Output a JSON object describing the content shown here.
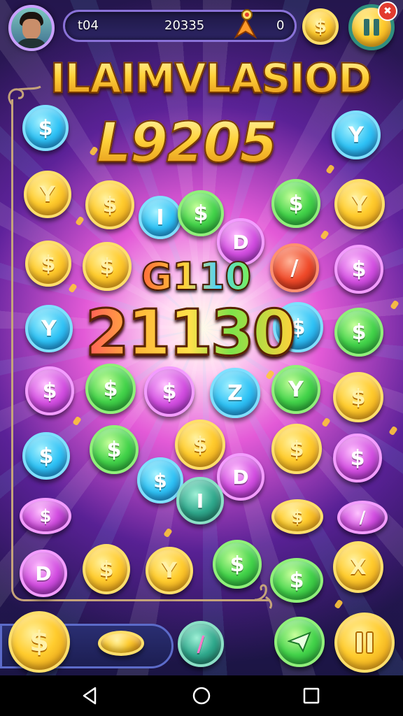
{
  "top_bar": {
    "avatar": "player-avatar",
    "stat_left": "t04",
    "stat_mid": "20335",
    "stat_right": "0",
    "rocket_icon": "rocket-icon",
    "coin_button_icon": "dollar-coin-icon",
    "pause_button_icon": "pause-icon",
    "close_badge": "✖"
  },
  "title": "ILAIMVLASIOD",
  "score": "L9205",
  "combo_text": "G110",
  "points_text": "21130",
  "coins": [
    {
      "color": "cyan",
      "symbol": "$"
    },
    {
      "color": "cyan",
      "symbol": "Y"
    },
    {
      "color": "gold",
      "symbol": "Y"
    },
    {
      "color": "gold",
      "symbol": "$"
    },
    {
      "color": "cyan",
      "symbol": "I"
    },
    {
      "color": "green",
      "symbol": "$"
    },
    {
      "color": "green",
      "symbol": "$"
    },
    {
      "color": "gold",
      "symbol": "Y"
    },
    {
      "color": "magenta",
      "symbol": "D"
    },
    {
      "color": "gold",
      "symbol": "$"
    },
    {
      "color": "gold",
      "symbol": "$"
    },
    {
      "color": "red",
      "symbol": "/"
    },
    {
      "color": "magenta",
      "symbol": "$"
    },
    {
      "color": "cyan",
      "symbol": "Y"
    },
    {
      "color": "cyan",
      "symbol": "$"
    },
    {
      "color": "green",
      "symbol": "$"
    },
    {
      "color": "magenta",
      "symbol": "$"
    },
    {
      "color": "green",
      "symbol": "$"
    },
    {
      "color": "magenta",
      "symbol": "$"
    },
    {
      "color": "cyan",
      "symbol": "Z"
    },
    {
      "color": "green",
      "symbol": "Y"
    },
    {
      "color": "gold",
      "symbol": "$"
    },
    {
      "color": "cyan",
      "symbol": "$"
    },
    {
      "color": "green",
      "symbol": "$"
    },
    {
      "color": "gold",
      "symbol": "$"
    },
    {
      "color": "gold",
      "symbol": "$"
    },
    {
      "color": "magenta",
      "symbol": "$"
    },
    {
      "color": "cyan",
      "symbol": "$"
    },
    {
      "color": "magenta",
      "symbol": "D"
    },
    {
      "color": "teal",
      "symbol": "I"
    },
    {
      "color": "magenta",
      "symbol": "$"
    },
    {
      "color": "gold",
      "symbol": "$"
    },
    {
      "color": "green",
      "symbol": "$"
    },
    {
      "color": "magenta",
      "symbol": "/"
    },
    {
      "color": "magenta",
      "symbol": "D"
    },
    {
      "color": "gold",
      "symbol": "$"
    },
    {
      "color": "gold",
      "symbol": "Y"
    },
    {
      "color": "green",
      "symbol": "$"
    },
    {
      "color": "gold",
      "symbol": "X"
    },
    {
      "color": "gold",
      "symbol": "$"
    }
  ],
  "bottom_bar": {
    "coin_button_symbol": "$",
    "pencil_button_symbol": "/",
    "play_button_icon": "paper-plane-icon",
    "pause_button_icon": "pause-icon"
  },
  "navbar": {
    "back_icon": "back-triangle-icon",
    "home_icon": "home-circle-icon",
    "recents_icon": "recents-square-icon"
  },
  "colors": {
    "gold": "#ffcc2e",
    "cyan": "#2fc2f5",
    "green": "#43d34a",
    "magenta": "#d24ee0",
    "red": "#ef4a2a",
    "teal": "#2fa88c",
    "background": "#2a1658"
  }
}
